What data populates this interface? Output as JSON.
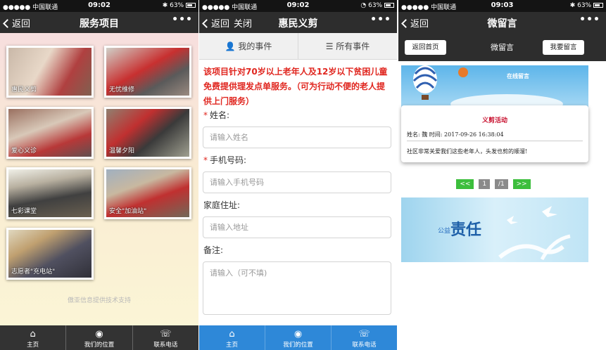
{
  "status": {
    "s1": {
      "carrier": "●●●●● 中国联通",
      "time": "09:02",
      "battery": "63%"
    },
    "s2": {
      "carrier": "●●●●● 中国联通",
      "time": "09:02",
      "battery": "63%"
    },
    "s3": {
      "carrier": "●●●●● 中国联通",
      "time": "09:03",
      "battery": "63%"
    }
  },
  "panel1": {
    "back": "返回",
    "title": "服务项目",
    "more": "•••",
    "tiles": [
      {
        "label": "惠民义剪"
      },
      {
        "label": "无忧维修"
      },
      {
        "label": "爱心义诊"
      },
      {
        "label": "温馨夕阳"
      },
      {
        "label": "七彩课堂"
      },
      {
        "label": "安全\"加油站\""
      },
      {
        "label": "志愿者\"充电站\""
      }
    ],
    "credit": "傲亚信息提供技术支持",
    "tabs": [
      {
        "label": "主页"
      },
      {
        "label": "我们的位置"
      },
      {
        "label": "联系电话"
      }
    ]
  },
  "panel2": {
    "back": "返回",
    "close": "关闭",
    "title": "惠民义剪",
    "more": "•••",
    "seg_my": "我的事件",
    "seg_all": "所有事件",
    "notice": "该项目针对70岁以上老年人及12岁以下贫困儿童免费提供理发点单服务。（可为行动不便的老人提供上门服务）",
    "fields": {
      "name_label": "姓名:",
      "name_ph": "请输入姓名",
      "phone_label": "手机号码:",
      "phone_ph": "请输入手机号码",
      "addr_label": "家庭住址:",
      "addr_ph": "请输入地址",
      "note_label": "备注:",
      "note_ph": "请输入（可不填)"
    },
    "required_mark": "*",
    "tabs": [
      {
        "label": "主页"
      },
      {
        "label": "我们的位置"
      },
      {
        "label": "联系电话"
      }
    ]
  },
  "panel3": {
    "back": "返回",
    "title": "微留言",
    "more": "•••",
    "home_btn": "返回首页",
    "bar_title": "微留言",
    "leave_btn": "我要留言",
    "banner_text": "在线留言",
    "card": {
      "title": "义剪活动",
      "meta": "姓名: 魏   时间: 2017-09-26 16:38:04",
      "msg": "社区非常关爱我们这些老年人，头发也剪的顺溜!"
    },
    "pager": {
      "prev": "<<",
      "page": "1",
      "total": "/1",
      "next": ">>"
    },
    "banner2": {
      "a": "公益",
      "b": "责任"
    }
  },
  "colors": {
    "accent_red": "#e0261f",
    "tab_blue": "#2e88d8",
    "pager_green": "#3cbe3c"
  }
}
